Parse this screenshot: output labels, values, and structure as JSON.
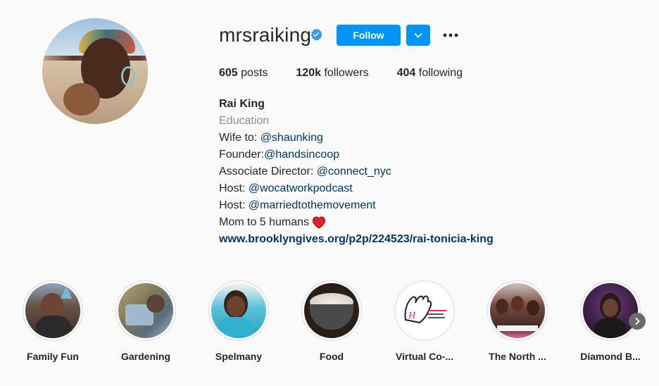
{
  "profile": {
    "username": "mrsraiking",
    "verified": true,
    "follow_label": "Follow",
    "stats": {
      "posts_count": "605",
      "posts_label": "posts",
      "followers_count": "120k",
      "followers_label": "followers",
      "following_count": "404",
      "following_label": "following"
    },
    "bio": {
      "name": "Rai King",
      "category": "Education",
      "line1_prefix": "Wife to: ",
      "line1_mention": "@shaunking",
      "line2_prefix": "Founder:",
      "line2_mention": "@handsincoop",
      "line3_prefix": "Associate Director: ",
      "line3_mention": "@connect_nyc",
      "line4_prefix": "Host: ",
      "line4_mention": "@wocatworkpodcast",
      "line5_prefix": "Host: ",
      "line5_mention": "@marriedtothemovement",
      "line6": "Mom to 5 humans",
      "website": "www.brooklyngives.org/p2p/224523/rai-tonicia-king"
    }
  },
  "highlights": [
    {
      "label": "Family Fun"
    },
    {
      "label": "Gardening"
    },
    {
      "label": "Spelmany"
    },
    {
      "label": "Food"
    },
    {
      "label": "Virtual Co-..."
    },
    {
      "label": "The North ..."
    },
    {
      "label": "Diamond B..."
    }
  ],
  "colors": {
    "accent": "#0095f6",
    "mention": "#00376b",
    "muted": "#8e8e8e",
    "heart": "#ed4956"
  },
  "icons": {
    "verified": "verified-badge-icon",
    "dropdown": "chevron-down-icon",
    "more": "more-options-icon",
    "heart": "heart-emoji-icon",
    "next": "chevron-right-icon"
  }
}
